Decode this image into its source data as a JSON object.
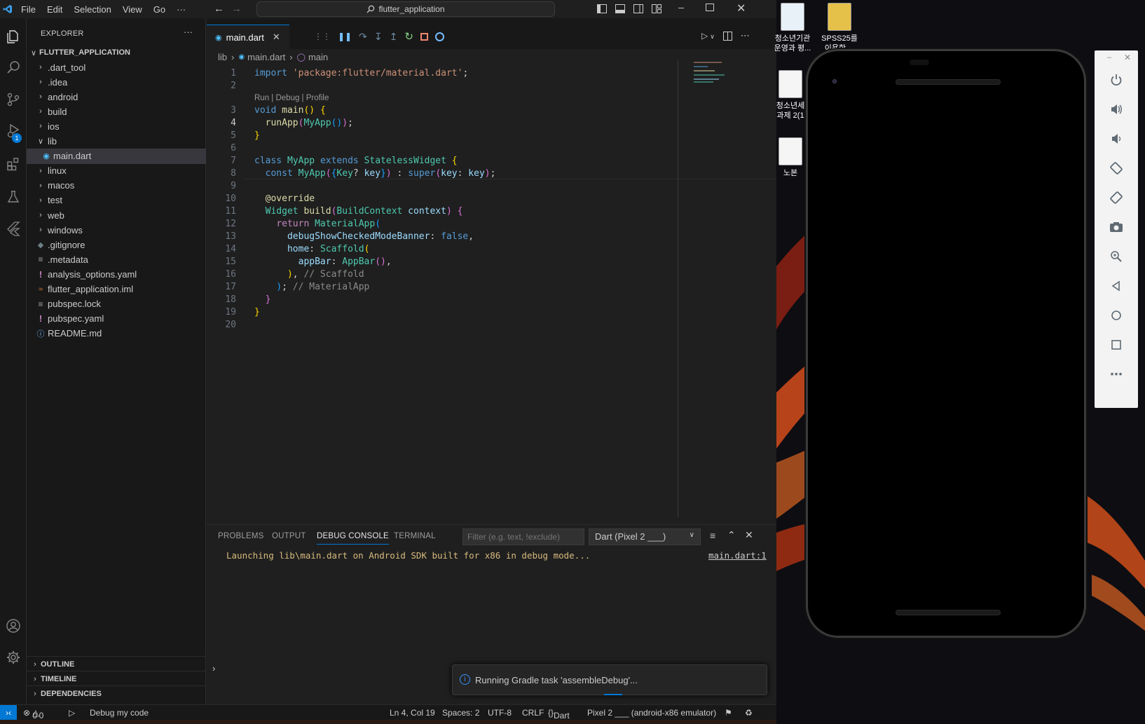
{
  "titlebar": {
    "menu": [
      "File",
      "Edit",
      "Selection",
      "View",
      "Go",
      "···"
    ],
    "search": "flutter_application"
  },
  "activity": {
    "debug_badge": "1"
  },
  "explorer": {
    "header": "EXPLORER",
    "more": "···",
    "root": "FLUTTER_APPLICATION",
    "items": [
      {
        "label": ".dart_tool",
        "kind": "folder"
      },
      {
        "label": ".idea",
        "kind": "folder"
      },
      {
        "label": "android",
        "kind": "folder"
      },
      {
        "label": "build",
        "kind": "folder"
      },
      {
        "label": "ios",
        "kind": "folder"
      },
      {
        "label": "lib",
        "kind": "folder-open"
      },
      {
        "label": "main.dart",
        "kind": "dart"
      },
      {
        "label": "linux",
        "kind": "folder"
      },
      {
        "label": "macos",
        "kind": "folder"
      },
      {
        "label": "test",
        "kind": "folder"
      },
      {
        "label": "web",
        "kind": "folder"
      },
      {
        "label": "windows",
        "kind": "folder"
      },
      {
        "label": ".gitignore",
        "kind": "git"
      },
      {
        "label": ".metadata",
        "kind": "lines"
      },
      {
        "label": "analysis_options.yaml",
        "kind": "yaml"
      },
      {
        "label": "flutter_application.iml",
        "kind": "rss"
      },
      {
        "label": "pubspec.lock",
        "kind": "lines"
      },
      {
        "label": "pubspec.yaml",
        "kind": "yaml"
      },
      {
        "label": "README.md",
        "kind": "info"
      }
    ],
    "sections": [
      "OUTLINE",
      "TIMELINE",
      "DEPENDENCIES"
    ]
  },
  "editor": {
    "tab": "main.dart",
    "breadcrumb": [
      "lib",
      "main.dart",
      "main"
    ],
    "codelens": "Run | Debug | Profile",
    "line_numbers": [
      "1",
      "2",
      "3",
      "4",
      "5",
      "6",
      "7",
      "8",
      "9",
      "10",
      "11",
      "12",
      "13",
      "14",
      "15",
      "16",
      "17",
      "18",
      "19",
      "20"
    ]
  },
  "panel": {
    "tabs": [
      "PROBLEMS",
      "OUTPUT",
      "DEBUG CONSOLE",
      "TERMINAL"
    ],
    "filter_placeholder": "Filter (e.g. text, !exclude)",
    "device": "Dart (Pixel 2 ___)",
    "output": "Launching lib\\main.dart on Android SDK built for x86 in debug mode...",
    "link": "main.dart:1"
  },
  "toast": {
    "text": "Running Gradle task 'assembleDebug'..."
  },
  "status": {
    "errors": "0",
    "warnings": "0",
    "debug": "Debug my code",
    "position": "Ln 4, Col 19",
    "spaces": "Spaces: 2",
    "encoding": "UTF-8",
    "eol": "CRLF",
    "language": "Dart",
    "device": "Pixel 2 ___ (android-x86 emulator)"
  },
  "desktop": {
    "icons": [
      {
        "label": "청소년기관\n운영과 평..."
      },
      {
        "label": "SPSS25를\n이용한 ..."
      },
      {
        "label": "청소년세\n과제 2(1"
      },
      {
        "label": "노본"
      }
    ]
  },
  "colors": {
    "accent": "#0078d4",
    "bg": "#1f1f1f",
    "sidebar": "#181818"
  }
}
